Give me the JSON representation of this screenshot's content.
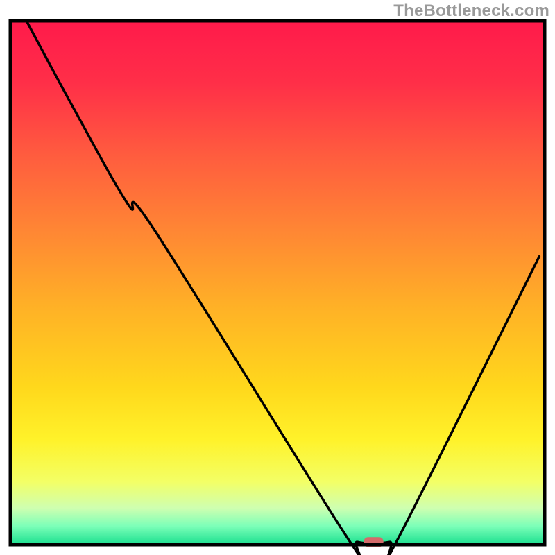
{
  "watermark": "TheBottleneck.com",
  "chart_data": {
    "type": "line",
    "title": "",
    "xlabel": "",
    "ylabel": "",
    "xlim": [
      0,
      100
    ],
    "ylim": [
      0,
      100
    ],
    "grid": false,
    "legend": false,
    "series": [
      {
        "name": "bottleneck-curve",
        "x": [
          3,
          12,
          22,
          27,
          62,
          65,
          71,
          73,
          99
        ],
        "y": [
          100,
          83,
          65,
          60,
          3,
          0.5,
          0.5,
          2,
          55
        ]
      }
    ],
    "marker": {
      "name": "optimum-marker",
      "x": 68,
      "y": 0.5,
      "color": "#d46a6a"
    },
    "gradient_stops": [
      {
        "offset": 0.0,
        "color": "#ff1a4b"
      },
      {
        "offset": 0.12,
        "color": "#ff2f48"
      },
      {
        "offset": 0.25,
        "color": "#ff5a3f"
      },
      {
        "offset": 0.4,
        "color": "#ff8634"
      },
      {
        "offset": 0.55,
        "color": "#ffb226"
      },
      {
        "offset": 0.7,
        "color": "#ffd81c"
      },
      {
        "offset": 0.8,
        "color": "#fff22a"
      },
      {
        "offset": 0.88,
        "color": "#f3ff66"
      },
      {
        "offset": 0.93,
        "color": "#cfffb0"
      },
      {
        "offset": 0.965,
        "color": "#7bffb8"
      },
      {
        "offset": 1.0,
        "color": "#1adf8f"
      }
    ],
    "frame": {
      "stroke": "#000000",
      "width": 5
    }
  }
}
